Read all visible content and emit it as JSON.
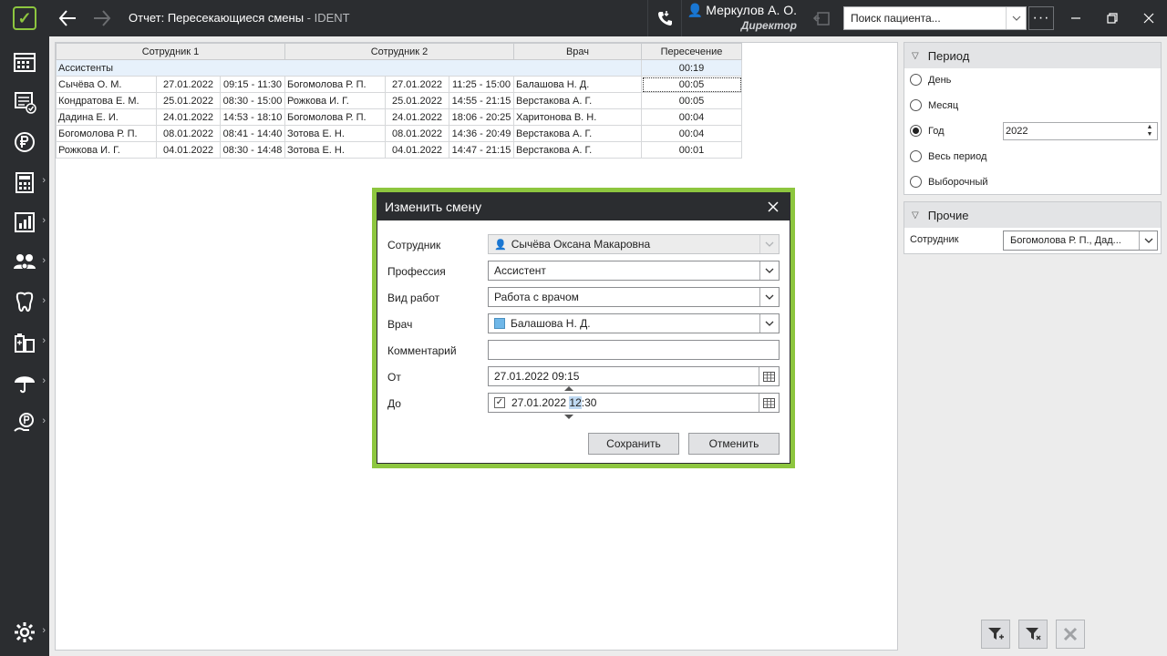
{
  "titlebar": {
    "title": "Отчет: Пересекающиеся смены",
    "app_suffix": " - IDENT",
    "user_name": "Меркулов А. О.",
    "user_role": "Директор",
    "search_placeholder": "Поиск пациента...",
    "more_label": "···"
  },
  "report": {
    "headers": [
      "Сотрудник 1",
      "Сотрудник 2",
      "Врач",
      "Пересечение"
    ],
    "group": {
      "label": "Ассистенты",
      "total": "00:19"
    },
    "rows": [
      {
        "emp1": "Сычёва О. М.",
        "date1": "27.01.2022",
        "time1": "09:15 - 11:30",
        "emp2": "Богомолова Р. П.",
        "date2": "27.01.2022",
        "time2": "11:25 - 15:00",
        "doctor": "Балашова Н. Д.",
        "overlap": "00:05"
      },
      {
        "emp1": "Кондратова Е. М.",
        "date1": "25.01.2022",
        "time1": "08:30 - 15:00",
        "emp2": "Рожкова И. Г.",
        "date2": "25.01.2022",
        "time2": "14:55 - 21:15",
        "doctor": "Верстакова А. Г.",
        "overlap": "00:05"
      },
      {
        "emp1": "Дадина Е. И.",
        "date1": "24.01.2022",
        "time1": "14:53 - 18:10",
        "emp2": "Богомолова Р. П.",
        "date2": "24.01.2022",
        "time2": "18:06 - 20:25",
        "doctor": "Харитонова В. Н.",
        "overlap": "00:04"
      },
      {
        "emp1": "Богомолова Р. П.",
        "date1": "08.01.2022",
        "time1": "08:41 - 14:40",
        "emp2": "Зотова Е. Н.",
        "date2": "08.01.2022",
        "time2": "14:36 - 20:49",
        "doctor": "Верстакова А. Г.",
        "overlap": "00:04"
      },
      {
        "emp1": "Рожкова И. Г.",
        "date1": "04.01.2022",
        "time1": "08:30 - 14:48",
        "emp2": "Зотова Е. Н.",
        "date2": "04.01.2022",
        "time2": "14:47 - 21:15",
        "doctor": "Верстакова А. Г.",
        "overlap": "00:01"
      }
    ]
  },
  "period": {
    "title": "Период",
    "options": [
      "День",
      "Месяц",
      "Год",
      "Весь период",
      "Выборочный"
    ],
    "selected": "Год",
    "year": "2022"
  },
  "other": {
    "title": "Прочие",
    "employee_label": "Сотрудник",
    "employee_value": "Богомолова Р. П., Дад..."
  },
  "dialog": {
    "title": "Изменить смену",
    "employee_label": "Сотрудник",
    "employee_value": "Сычёва Оксана Макаровна",
    "profession_label": "Профессия",
    "profession_value": "Ассистент",
    "worktype_label": "Вид работ",
    "worktype_value": "Работа с врачом",
    "doctor_label": "Врач",
    "doctor_value": "Балашова Н. Д.",
    "comment_label": "Комментарий",
    "comment_value": "",
    "from_label": "От",
    "from_value": "27.01.2022 09:15",
    "to_label": "До",
    "to_date": "27.01.2022 ",
    "to_hour": "12",
    "to_minute": ":30",
    "save_label": "Сохранить",
    "cancel_label": "Отменить"
  },
  "colors": {
    "accent": "#8dc63f",
    "dark": "#2b2d30",
    "group_row": "#e7f1fb"
  }
}
